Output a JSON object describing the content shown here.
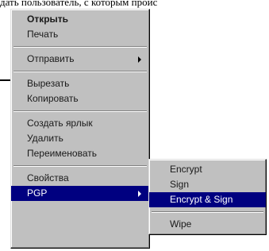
{
  "background": {
    "text": "дать пользователь, с которым проис"
  },
  "context_menu": {
    "open": "Открыть",
    "print": "Печать",
    "send_to": "Отправить",
    "cut": "Вырезать",
    "copy": "Копировать",
    "create_shortcut": "Создать ярлык",
    "delete": "Удалить",
    "rename": "Переименовать",
    "properties": "Свойства",
    "pgp": "PGP"
  },
  "pgp_submenu": {
    "encrypt": "Encrypt",
    "sign": "Sign",
    "encrypt_sign": "Encrypt & Sign",
    "wipe": "Wipe"
  },
  "colors": {
    "menu_bg": "#c0c0c0",
    "highlight": "#000080"
  }
}
